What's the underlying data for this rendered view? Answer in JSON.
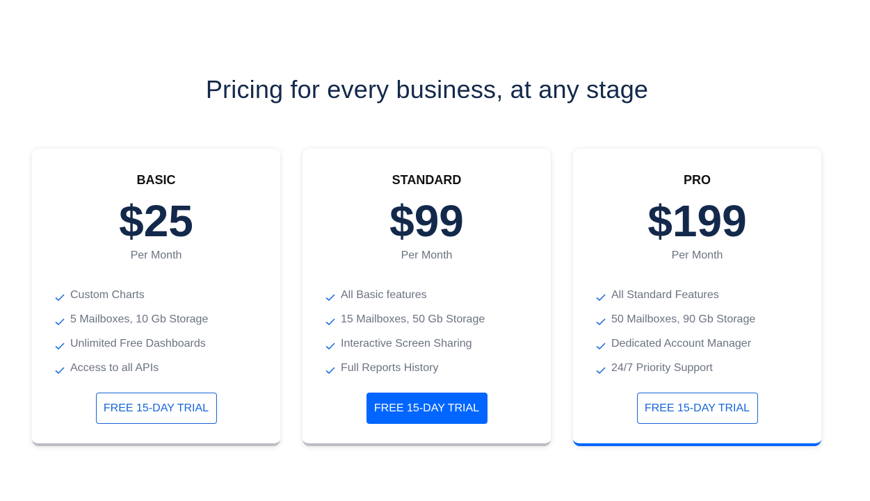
{
  "title": "Pricing for every business, at any stage",
  "accent_color": "#0066ff",
  "plans": [
    {
      "name": "BASIC",
      "price": "$25",
      "period": "Per Month",
      "features": [
        "Custom Charts",
        "5 Mailboxes, 10 Gb Storage",
        "Unlimited Free Dashboards",
        "Access to all APIs"
      ],
      "button_label": "FREE 15-DAY TRIAL",
      "button_style": "outline"
    },
    {
      "name": "STANDARD",
      "price": "$99",
      "period": "Per Month",
      "features": [
        "All Basic features",
        "15 Mailboxes, 50 Gb Storage",
        "Interactive Screen Sharing",
        "Full Reports History"
      ],
      "button_label": "FREE 15-DAY TRIAL",
      "button_style": "filled"
    },
    {
      "name": "PRO",
      "price": "$199",
      "period": "Per Month",
      "features": [
        "All Standard Features",
        "50 Mailboxes, 90 Gb Storage",
        "Dedicated Account Manager",
        "24/7 Priority Support"
      ],
      "button_label": "FREE 15-DAY TRIAL",
      "button_style": "outline"
    }
  ],
  "icons": {
    "feature_bullet": "check-icon"
  }
}
